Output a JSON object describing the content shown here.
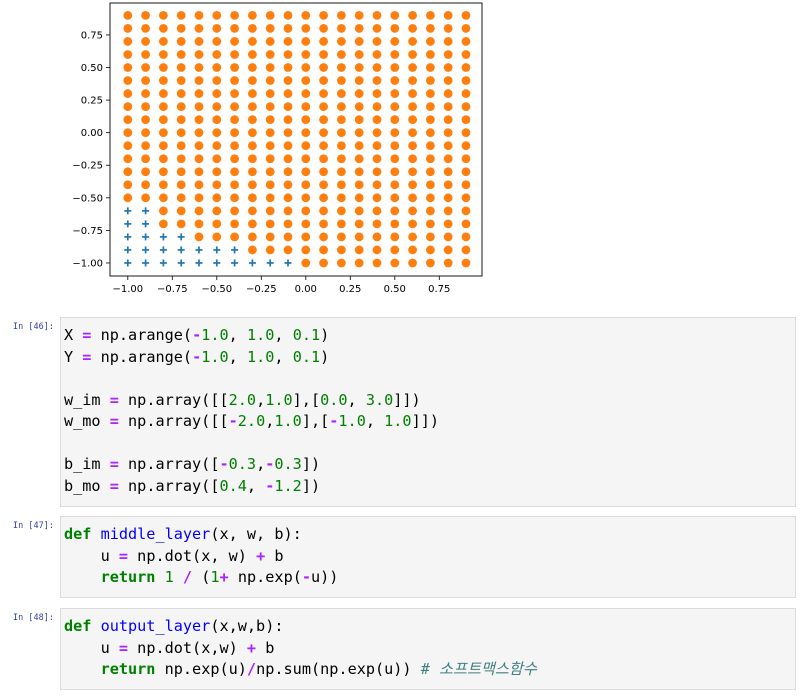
{
  "chart_data": {
    "type": "scatter",
    "title": "",
    "xlabel": "",
    "ylabel": "",
    "xlim": [
      -1.1,
      0.99
    ],
    "ylim": [
      -1.1,
      0.995
    ],
    "xticks": [
      "-1.00",
      "-0.75",
      "-0.50",
      "-0.25",
      "0.00",
      "0.25",
      "0.50",
      "0.75"
    ],
    "yticks": [
      "-1.00",
      "-0.75",
      "-0.50",
      "-0.25",
      "0.00",
      "0.25",
      "0.50",
      "0.75"
    ],
    "grid": false,
    "grid_x": [
      -1.0,
      0.9,
      0.1
    ],
    "grid_y": [
      -1.0,
      0.9,
      0.1
    ],
    "series": [
      {
        "marker": "plus",
        "color": "#1f77b4",
        "rule": "cells where the middle/output layer predicts class 0 (lower-left region)",
        "count_per_row_from_bottom": [
          10,
          7,
          4,
          2,
          2
        ]
      },
      {
        "marker": "circle",
        "color": "#ff7f0e",
        "rule": "all remaining grid cells"
      }
    ]
  },
  "cells": [
    {
      "prompt": "In [46]:",
      "lines": [
        [
          [
            "",
            "X "
          ],
          [
            "op",
            "="
          ],
          [
            "",
            " np"
          ],
          [
            "",
            "."
          ],
          [
            "",
            "arange("
          ],
          [
            "op",
            "-"
          ],
          [
            "num",
            "1.0"
          ],
          [
            "",
            ", "
          ],
          [
            "num",
            "1.0"
          ],
          [
            "",
            ", "
          ],
          [
            "num",
            "0.1"
          ],
          [
            "",
            ")"
          ]
        ],
        [
          [
            "",
            "Y "
          ],
          [
            "op",
            "="
          ],
          [
            "",
            " np"
          ],
          [
            "",
            "."
          ],
          [
            "",
            "arange("
          ],
          [
            "op",
            "-"
          ],
          [
            "num",
            "1.0"
          ],
          [
            "",
            ", "
          ],
          [
            "num",
            "1.0"
          ],
          [
            "",
            ", "
          ],
          [
            "num",
            "0.1"
          ],
          [
            "",
            ")"
          ]
        ],
        [],
        [
          [
            "",
            "w_im "
          ],
          [
            "op",
            "="
          ],
          [
            "",
            " np"
          ],
          [
            "",
            "."
          ],
          [
            "",
            "array([["
          ],
          [
            "num",
            "2.0"
          ],
          [
            "",
            ","
          ],
          [
            "num",
            "1.0"
          ],
          [
            "",
            "],["
          ],
          [
            "num",
            "0.0"
          ],
          [
            "",
            ", "
          ],
          [
            "num",
            "3.0"
          ],
          [
            "",
            "]])"
          ]
        ],
        [
          [
            "",
            "w_mo "
          ],
          [
            "op",
            "="
          ],
          [
            "",
            " np"
          ],
          [
            "",
            "."
          ],
          [
            "",
            "array([["
          ],
          [
            "op",
            "-"
          ],
          [
            "num",
            "2.0"
          ],
          [
            "",
            ","
          ],
          [
            "num",
            "1.0"
          ],
          [
            "",
            "],["
          ],
          [
            "op",
            "-"
          ],
          [
            "num",
            "1.0"
          ],
          [
            "",
            ", "
          ],
          [
            "num",
            "1.0"
          ],
          [
            "",
            "]])"
          ]
        ],
        [],
        [
          [
            "",
            "b_im "
          ],
          [
            "op",
            "="
          ],
          [
            "",
            " np"
          ],
          [
            "",
            "."
          ],
          [
            "",
            "array(["
          ],
          [
            "op",
            "-"
          ],
          [
            "num",
            "0.3"
          ],
          [
            "",
            ","
          ],
          [
            "op",
            "-"
          ],
          [
            "num",
            "0.3"
          ],
          [
            "",
            "])"
          ]
        ],
        [
          [
            "",
            "b_mo "
          ],
          [
            "op",
            "="
          ],
          [
            "",
            " np"
          ],
          [
            "",
            "."
          ],
          [
            "",
            "array(["
          ],
          [
            "num",
            "0.4"
          ],
          [
            "",
            ", "
          ],
          [
            "op",
            "-"
          ],
          [
            "num",
            "1.2"
          ],
          [
            "",
            "])"
          ]
        ]
      ]
    },
    {
      "prompt": "In [47]:",
      "lines": [
        [
          [
            "kw",
            "def"
          ],
          [
            "",
            " "
          ],
          [
            "fn",
            "middle_layer"
          ],
          [
            "",
            "(x, w, b):"
          ]
        ],
        [
          [
            "",
            "    u "
          ],
          [
            "op",
            "="
          ],
          [
            "",
            " np"
          ],
          [
            "",
            "."
          ],
          [
            "",
            "dot(x, w) "
          ],
          [
            "op",
            "+"
          ],
          [
            "",
            " b"
          ]
        ],
        [
          [
            "",
            "    "
          ],
          [
            "kw",
            "return"
          ],
          [
            "",
            " "
          ],
          [
            "num",
            "1"
          ],
          [
            "",
            " "
          ],
          [
            "op",
            "/"
          ],
          [
            "",
            " ("
          ],
          [
            "num",
            "1"
          ],
          [
            "op",
            "+"
          ],
          [
            "",
            " np"
          ],
          [
            "",
            "."
          ],
          [
            "",
            "exp("
          ],
          [
            "op",
            "-"
          ],
          [
            "",
            "u))"
          ]
        ]
      ]
    },
    {
      "prompt": "In [48]:",
      "lines": [
        [
          [
            "kw",
            "def"
          ],
          [
            "",
            " "
          ],
          [
            "fn",
            "output_layer"
          ],
          [
            "",
            "(x,w,b):"
          ]
        ],
        [
          [
            "",
            "    u "
          ],
          [
            "op",
            "="
          ],
          [
            "",
            " np"
          ],
          [
            "",
            "."
          ],
          [
            "",
            "dot(x,w) "
          ],
          [
            "op",
            "+"
          ],
          [
            "",
            " b"
          ]
        ],
        [
          [
            "",
            "    "
          ],
          [
            "kw",
            "return"
          ],
          [
            "",
            " np"
          ],
          [
            "",
            "."
          ],
          [
            "",
            "exp(u)"
          ],
          [
            "op",
            "/"
          ],
          [
            "",
            "np"
          ],
          [
            "",
            "."
          ],
          [
            "",
            "sum(np"
          ],
          [
            "",
            "."
          ],
          [
            "",
            "exp(u)) "
          ],
          [
            "cm",
            "# 소프트맥스함수"
          ]
        ]
      ]
    }
  ]
}
